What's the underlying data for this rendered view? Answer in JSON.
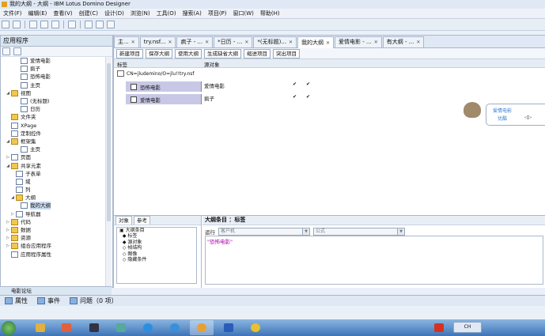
{
  "window": {
    "title": "我的大纲 - 大纲 - IBM Lotus Domino Designer"
  },
  "menu": [
    "文件(F)",
    "编辑(E)",
    "查看(V)",
    "创建(C)",
    "设计(D)",
    "浏览(N)",
    "工具(O)",
    "搜索(A)",
    "项目(P)",
    "窗口(W)",
    "帮助(H)"
  ],
  "left_pane": {
    "title": "应用程序",
    "tree": [
      {
        "label": "爱情电影",
        "indent": 3,
        "icon": "view",
        "twisty": ""
      },
      {
        "label": "疯子",
        "indent": 3,
        "icon": "view",
        "twisty": ""
      },
      {
        "label": "恐怖电影",
        "indent": 3,
        "icon": "view",
        "twisty": ""
      },
      {
        "label": "主页",
        "indent": 3,
        "icon": "view",
        "twisty": ""
      },
      {
        "label": "视图",
        "indent": 1,
        "icon": "folder",
        "twisty": "◢"
      },
      {
        "label": "(无标题)",
        "indent": 3,
        "icon": "view",
        "twisty": ""
      },
      {
        "label": "日历",
        "indent": 3,
        "icon": "view",
        "twisty": ""
      },
      {
        "label": "文件夹",
        "indent": 1,
        "icon": "folder",
        "twisty": ""
      },
      {
        "label": "XPage",
        "indent": 1,
        "icon": "view",
        "twisty": ""
      },
      {
        "label": "定制控件",
        "indent": 1,
        "icon": "view",
        "twisty": ""
      },
      {
        "label": "框架集",
        "indent": 1,
        "icon": "folder",
        "twisty": "◢"
      },
      {
        "label": "主页",
        "indent": 3,
        "icon": "view",
        "twisty": ""
      },
      {
        "label": "页面",
        "indent": 1,
        "icon": "view",
        "twisty": "▷"
      },
      {
        "label": "共享元素",
        "indent": 1,
        "icon": "folder",
        "twisty": "◢"
      },
      {
        "label": "子表单",
        "indent": 2,
        "icon": "view",
        "twisty": ""
      },
      {
        "label": "域",
        "indent": 2,
        "icon": "view",
        "twisty": ""
      },
      {
        "label": "列",
        "indent": 2,
        "icon": "view",
        "twisty": ""
      },
      {
        "label": "大纲",
        "indent": 2,
        "icon": "folder",
        "twisty": "◢"
      },
      {
        "label": "我的大纲",
        "indent": 3,
        "icon": "view",
        "twisty": "",
        "selected": true
      },
      {
        "label": "导航器",
        "indent": 2,
        "icon": "view",
        "twisty": "▷"
      },
      {
        "label": "代码",
        "indent": 1,
        "icon": "folder",
        "twisty": "▷"
      },
      {
        "label": "数据",
        "indent": 1,
        "icon": "folder",
        "twisty": "▷"
      },
      {
        "label": "资源",
        "indent": 1,
        "icon": "folder",
        "twisty": "▷"
      },
      {
        "label": "组合应用程序",
        "indent": 1,
        "icon": "folder",
        "twisty": "▷"
      },
      {
        "label": "应用程序属性",
        "indent": 1,
        "icon": "view",
        "twisty": ""
      }
    ],
    "footer": "电影论坛"
  },
  "tabs": [
    {
      "label": "主...",
      "active": false
    },
    {
      "label": "try.nsf...",
      "active": false
    },
    {
      "label": "疯子 - ...",
      "active": false
    },
    {
      "label": "*日历 - ...",
      "active": false
    },
    {
      "label": "*(无标题)...",
      "active": false
    },
    {
      "label": "我的大纲",
      "active": true
    },
    {
      "label": "爱情电影 - ...",
      "active": false
    },
    {
      "label": "有大纲 - ...",
      "active": false
    }
  ],
  "actions": [
    "新建项目",
    "保存大纲",
    "使用大纲",
    "生成缺省大纲",
    "缩进项目",
    "突出项目"
  ],
  "outline": {
    "columns": {
      "label": "标签",
      "subject": "源对象"
    },
    "db_path": "CN=jludemino/O=jlu!!try.nsf",
    "rows": [
      {
        "label": "恐怖电影",
        "subject": "爱情电影",
        "check1": "✔",
        "check2": "✔"
      },
      {
        "label": "爱情电影",
        "subject": "疯子",
        "check1": "✔",
        "check2": "✔"
      }
    ]
  },
  "assistant": {
    "line1": "爱情电影",
    "line2": "优酷"
  },
  "props": {
    "tab_objects": "对象",
    "tab_reference": "参考",
    "tree": [
      "▣ 大纲条目",
      "  ◆ 标签",
      "  ◆ 源对象",
      "  ◇ 帧结构",
      "  ◇ 图像",
      "  ◇ 隐藏条件"
    ],
    "title": "大纲条目 ：标签",
    "run_label": "运行",
    "run_value": "客户机",
    "formula_select": "公式",
    "formula_text": "\"恐怖电影\""
  },
  "bottom_tabs": [
    "属性",
    "事件",
    "问题（0 项）"
  ],
  "taskbar": {
    "tray": "CH"
  }
}
